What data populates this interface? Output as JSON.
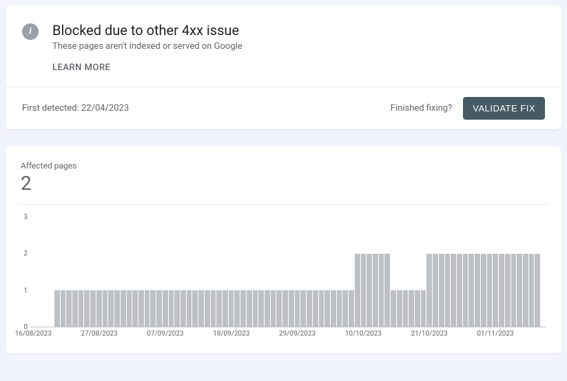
{
  "header": {
    "title": "Blocked due to other 4xx issue",
    "subtitle": "These pages aren't indexed or served on Google",
    "learn_more": "LEARN MORE"
  },
  "status": {
    "first_detected_label": "First detected: ",
    "first_detected_value": "22/04/2023",
    "finished_fixing": "Finished fixing?",
    "validate_fix": "VALIDATE FIX"
  },
  "affected": {
    "label": "Affected pages",
    "value": "2"
  },
  "chart_data": {
    "type": "bar",
    "title": "Affected pages",
    "xlabel": "",
    "ylabel": "",
    "ylim": [
      0,
      3
    ],
    "y_ticks": [
      0,
      1,
      2,
      3
    ],
    "x_tick_labels": [
      "16/08/2023",
      "27/08/2023",
      "07/09/2023",
      "18/09/2023",
      "29/09/2023",
      "10/10/2023",
      "21/10/2023",
      "01/11/2023"
    ],
    "x_tick_indices": [
      0,
      11,
      22,
      33,
      44,
      55,
      66,
      77
    ],
    "categories_start": "16/08/2023",
    "categories_end": "09/11/2023",
    "n_days": 86,
    "values": [
      0,
      0,
      0,
      0,
      1,
      1,
      1,
      1,
      1,
      1,
      1,
      1,
      1,
      1,
      1,
      1,
      1,
      1,
      1,
      1,
      1,
      1,
      1,
      1,
      1,
      1,
      1,
      1,
      1,
      1,
      1,
      1,
      1,
      1,
      1,
      1,
      1,
      1,
      1,
      1,
      1,
      1,
      1,
      1,
      1,
      1,
      1,
      1,
      1,
      1,
      1,
      1,
      1,
      1,
      2,
      2,
      2,
      2,
      2,
      2,
      1,
      1,
      1,
      1,
      1,
      1,
      2,
      2,
      2,
      2,
      2,
      2,
      2,
      2,
      2,
      2,
      2,
      2,
      2,
      2,
      2,
      2,
      2,
      2,
      2,
      0
    ]
  }
}
